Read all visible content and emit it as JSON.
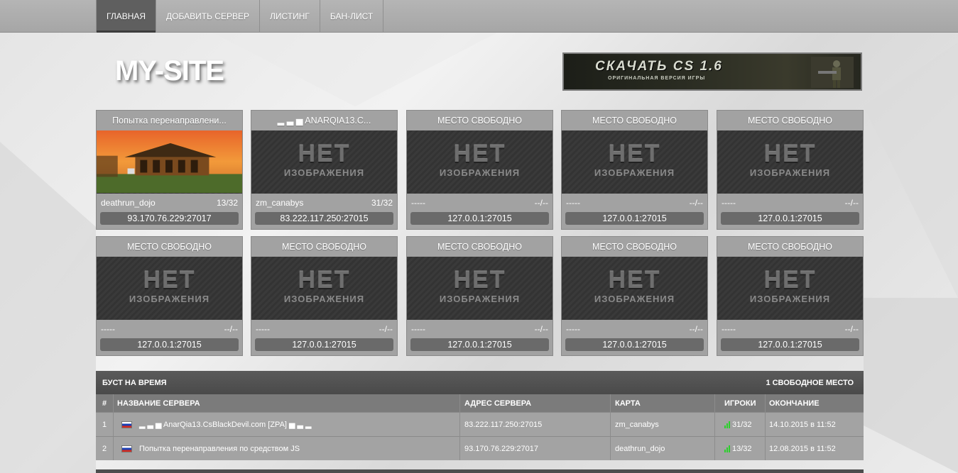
{
  "nav": {
    "items": [
      {
        "label": "ГЛАВНАЯ",
        "active": true
      },
      {
        "label": "ДОБАВИТЬ СЕРВЕР",
        "active": false
      },
      {
        "label": "ЛИСТИНГ",
        "active": false
      },
      {
        "label": "БАН-ЛИСТ",
        "active": false
      }
    ]
  },
  "logo": {
    "text": "MY-SITE"
  },
  "banner": {
    "title": "СКАЧАТЬ CS 1.6",
    "subtitle": "ОРИГИНАЛЬНАЯ ВЕРСИЯ ИГРЫ"
  },
  "no_image": {
    "big": "НЕТ",
    "small": "ИЗОБРАЖЕНИЯ"
  },
  "cards": [
    {
      "title": "Попытка перенаправлени...",
      "map": "deathrun_dojo",
      "players": "13/32",
      "address": "93.170.76.229:27017",
      "has_image": true
    },
    {
      "title": "▂ ▃ ▅ ANARQIA13.C...",
      "map": "zm_canabys",
      "players": "31/32",
      "address": "83.222.117.250:27015",
      "has_image": false
    },
    {
      "title": "МЕСТО СВОБОДНО",
      "map": "-----",
      "players": "--/--",
      "address": "127.0.0.1:27015",
      "has_image": false
    },
    {
      "title": "МЕСТО СВОБОДНО",
      "map": "-----",
      "players": "--/--",
      "address": "127.0.0.1:27015",
      "has_image": false
    },
    {
      "title": "МЕСТО СВОБОДНО",
      "map": "-----",
      "players": "--/--",
      "address": "127.0.0.1:27015",
      "has_image": false
    },
    {
      "title": "МЕСТО СВОБОДНО",
      "map": "-----",
      "players": "--/--",
      "address": "127.0.0.1:27015",
      "has_image": false
    },
    {
      "title": "МЕСТО СВОБОДНО",
      "map": "-----",
      "players": "--/--",
      "address": "127.0.0.1:27015",
      "has_image": false
    },
    {
      "title": "МЕСТО СВОБОДНО",
      "map": "-----",
      "players": "--/--",
      "address": "127.0.0.1:27015",
      "has_image": false
    },
    {
      "title": "МЕСТО СВОБОДНО",
      "map": "-----",
      "players": "--/--",
      "address": "127.0.0.1:27015",
      "has_image": false
    },
    {
      "title": "МЕСТО СВОБОДНО",
      "map": "-----",
      "players": "--/--",
      "address": "127.0.0.1:27015",
      "has_image": false
    }
  ],
  "boost": {
    "title": "БУСТ НА ВРЕМЯ",
    "free_slots": "1 СВОБОДНОЕ МЕСТО",
    "columns": [
      "#",
      "НАЗВАНИЕ СЕРВЕРА",
      "АДРЕС СЕРВЕРА",
      "КАРТА",
      "ИГРОКИ",
      "ОКОНЧАНИЕ"
    ],
    "rows": [
      {
        "num": "1",
        "name": "▂ ▃ ▅ AnarQia13.CsBlackDevil.com [ZPA] ▅ ▃ ▂",
        "address": "83.222.117.250:27015",
        "map": "zm_canabys",
        "players": "31/32",
        "end": "14.10.2015 в 11:52"
      },
      {
        "num": "2",
        "name": "Попытка перенаправления по средством JS",
        "address": "93.170.76.229:27017",
        "map": "deathrun_dojo",
        "players": "13/32",
        "end": "12.08.2015 в 11:52"
      }
    ]
  },
  "colors": {
    "signal": "#2bd12b",
    "header_dark": "#4a4a4a",
    "card_bg": "#a2a2a2"
  }
}
